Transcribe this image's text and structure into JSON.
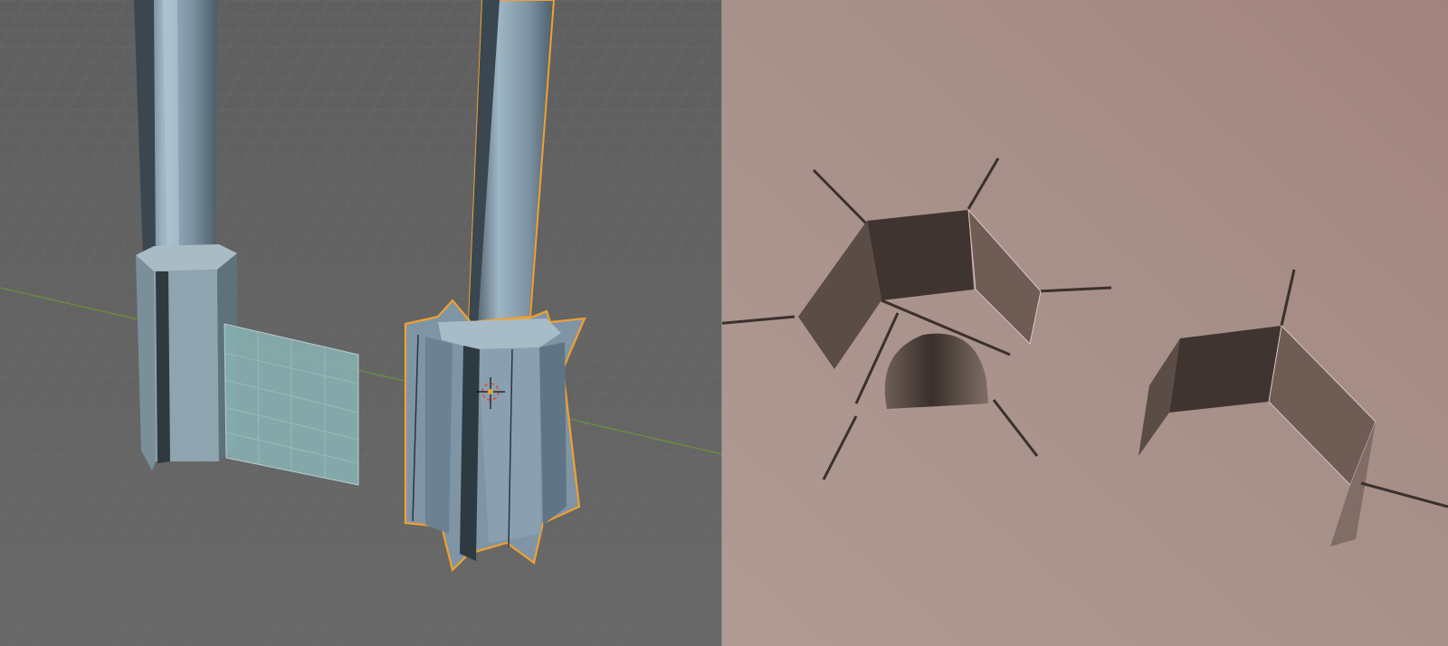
{
  "viewports": {
    "left": {
      "view_mode": "solid-edit",
      "grid": true,
      "objects": [
        "pillar-cross",
        "pillar-star-selected"
      ],
      "selection_outline_color": "#f0a030",
      "background_color": "#636363",
      "grid_color": "#6f6f6f",
      "axis_x_color": "#6b8f3a",
      "mesh_face_color": "#8ea0ad",
      "plane_face_color": "#8ab4b6",
      "cursor_icon": "3d-cursor-icon"
    },
    "right": {
      "view_mode": "render-bottom-up",
      "background_color": "#a58f89",
      "panel_dark_color": "#403430",
      "panel_light_color": "#6e5c55"
    }
  }
}
